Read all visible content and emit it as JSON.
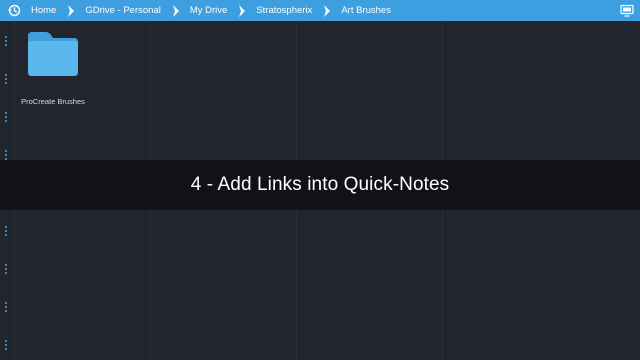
{
  "breadcrumb": {
    "items": [
      {
        "label": "Home"
      },
      {
        "label": "GDrive - Personal"
      },
      {
        "label": "My Drive"
      },
      {
        "label": "Stratospherix"
      },
      {
        "label": "Art Brushes"
      }
    ]
  },
  "files": [
    {
      "name": "ProCreate Brushes",
      "icon": "folder-icon"
    }
  ],
  "caption": {
    "text": "4 - Add Links into Quick-Notes"
  },
  "colors": {
    "topbar": "#3d9fe0",
    "background": "#22252d",
    "folder": "#5bb8ee",
    "accent_dots": "#49a8e8"
  }
}
